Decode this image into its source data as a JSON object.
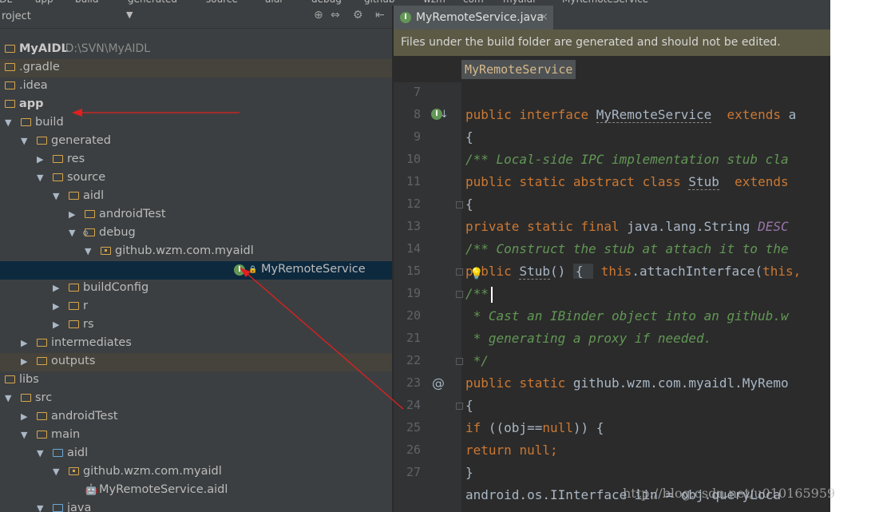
{
  "breadcrumbs": [
    "MyAIDL",
    "app",
    "build",
    "generated",
    "source",
    "aidl",
    "debug",
    "github",
    "wzm",
    "com",
    "myaidl",
    "MyRemoteService"
  ],
  "project_panel": {
    "label": "roject",
    "toolbar_icons": [
      "target-icon",
      "collapse-icon",
      "gear-icon",
      "hide-panel-icon"
    ]
  },
  "tree": [
    {
      "label": "MyAIDL",
      "suffix": "D:\\SVN\\MyAIDL",
      "depth": 0,
      "chevron": "",
      "icon": "module",
      "bold": true
    },
    {
      "label": ".gradle",
      "depth": 0,
      "chevron": "",
      "icon": "folder",
      "highlight": true
    },
    {
      "label": ".idea",
      "depth": 0,
      "chevron": "",
      "icon": "folder"
    },
    {
      "label": "app",
      "depth": 0,
      "chevron": "",
      "icon": "module",
      "bold": true
    },
    {
      "label": "build",
      "depth": 0,
      "chevron": "down",
      "icon": "folder"
    },
    {
      "label": "generated",
      "depth": 1,
      "chevron": "down",
      "icon": "folder"
    },
    {
      "label": "res",
      "depth": 2,
      "chevron": "right",
      "icon": "folder"
    },
    {
      "label": "source",
      "depth": 2,
      "chevron": "down",
      "icon": "folder"
    },
    {
      "label": "aidl",
      "depth": 3,
      "chevron": "down",
      "icon": "folder"
    },
    {
      "label": "androidTest",
      "depth": 4,
      "chevron": "right",
      "icon": "folder"
    },
    {
      "label": "debug",
      "depth": 4,
      "chevron": "down",
      "icon": "folder-gear"
    },
    {
      "label": "github.wzm.com.myaidl",
      "depth": 5,
      "chevron": "down",
      "icon": "package"
    },
    {
      "label": "MyRemoteService",
      "depth": 7,
      "chevron": "",
      "icon": "interface",
      "selected": true
    },
    {
      "label": "buildConfig",
      "depth": 3,
      "chevron": "right",
      "icon": "folder"
    },
    {
      "label": "r",
      "depth": 3,
      "chevron": "right",
      "icon": "folder"
    },
    {
      "label": "rs",
      "depth": 3,
      "chevron": "right",
      "icon": "folder"
    },
    {
      "label": "intermediates",
      "depth": 1,
      "chevron": "right",
      "icon": "folder"
    },
    {
      "label": "outputs",
      "depth": 1,
      "chevron": "right",
      "icon": "folder",
      "highlight": true
    },
    {
      "label": "libs",
      "depth": 0,
      "chevron": "",
      "icon": "folder"
    },
    {
      "label": "src",
      "depth": 0,
      "chevron": "down",
      "icon": "folder"
    },
    {
      "label": "androidTest",
      "depth": 1,
      "chevron": "right",
      "icon": "folder"
    },
    {
      "label": "main",
      "depth": 1,
      "chevron": "down",
      "icon": "folder"
    },
    {
      "label": "aidl",
      "depth": 2,
      "chevron": "down",
      "icon": "folder-blue"
    },
    {
      "label": "github.wzm.com.myaidl",
      "depth": 3,
      "chevron": "down",
      "icon": "package"
    },
    {
      "label": "MyRemoteService.aidl",
      "depth": 4,
      "chevron": "",
      "icon": "android"
    },
    {
      "label": "java",
      "depth": 2,
      "chevron": "down",
      "icon": "folder-blue"
    }
  ],
  "editor": {
    "tab_label": "MyRemoteService.java",
    "tab_badge": "I",
    "banner": "Files under the build folder are generated and should not be edited.",
    "breadcrumb_chip": "MyRemoteService",
    "lines": [
      {
        "n": "7",
        "parts": []
      },
      {
        "n": "8",
        "marker": "implements-icon",
        "parts": [
          [
            "kw",
            "public "
          ],
          [
            "kw",
            "interface "
          ],
          [
            "ul",
            "MyRemoteService"
          ],
          [
            "",
            "  "
          ],
          [
            "kw",
            "extends "
          ],
          [
            "",
            "a"
          ]
        ]
      },
      {
        "n": "9",
        "parts": [
          [
            "",
            "{"
          ]
        ]
      },
      {
        "n": "10",
        "parts": [
          [
            "cm",
            "/** Local-side IPC implementation stub cla"
          ]
        ]
      },
      {
        "n": "11",
        "parts": [
          [
            "kw",
            "public "
          ],
          [
            "kw",
            "static "
          ],
          [
            "kw",
            "abstract "
          ],
          [
            "kw",
            "class "
          ],
          [
            "ul",
            "Stub"
          ],
          [
            "",
            "  "
          ],
          [
            "kw",
            "extends "
          ]
        ]
      },
      {
        "n": "12",
        "fold": true,
        "parts": [
          [
            "",
            "{"
          ]
        ]
      },
      {
        "n": "13",
        "parts": [
          [
            "kw",
            "private "
          ],
          [
            "kw",
            "static "
          ],
          [
            "kw",
            "final "
          ],
          [
            "",
            "java.lang.String "
          ],
          [
            "ital",
            "DESC"
          ]
        ]
      },
      {
        "n": "14",
        "parts": [
          [
            "cm",
            "/** Construct the stub at attach it to the"
          ]
        ]
      },
      {
        "n": "15",
        "fold": true,
        "bulb": true,
        "parts": [
          [
            "kw",
            "public "
          ],
          [
            "ul",
            "Stub"
          ],
          [
            "",
            "() "
          ],
          [
            "foldchip",
            "{ "
          ],
          [
            "",
            " "
          ],
          [
            "kw",
            "this"
          ],
          [
            "",
            ".attachInterface("
          ],
          [
            "kw",
            "this"
          ],
          [
            "kw",
            ","
          ]
        ]
      },
      {
        "n": "19",
        "fold": true,
        "caret": true,
        "parts": [
          [
            "cm",
            "/**"
          ]
        ]
      },
      {
        "n": "20",
        "parts": [
          [
            "cm",
            " * Cast an IBinder object into an github.w"
          ]
        ]
      },
      {
        "n": "21",
        "parts": [
          [
            "cm",
            " * generating a proxy if needed."
          ]
        ]
      },
      {
        "n": "22",
        "fold": true,
        "parts": [
          [
            "cm",
            " */"
          ]
        ]
      },
      {
        "n": "23",
        "marker": "override-icon",
        "parts": [
          [
            "kw",
            "public "
          ],
          [
            "kw",
            "static "
          ],
          [
            "",
            "github.wzm.com.myaidl.MyRemo"
          ]
        ]
      },
      {
        "n": "24",
        "fold": true,
        "parts": [
          [
            "",
            "{"
          ]
        ]
      },
      {
        "n": "25",
        "parts": [
          [
            "kw",
            "if "
          ],
          [
            "",
            "((obj=="
          ],
          [
            "kw",
            "null"
          ],
          [
            "",
            ")) {"
          ]
        ]
      },
      {
        "n": "26",
        "parts": [
          [
            "kw",
            "return "
          ],
          [
            "kw",
            "null"
          ],
          [
            "kw",
            ";"
          ]
        ]
      },
      {
        "n": "27",
        "parts": [
          [
            "",
            "}"
          ]
        ]
      },
      {
        "n": "",
        "parts": [
          [
            "",
            "android.os.IInterface iin = obj.queryLoca"
          ]
        ]
      }
    ]
  },
  "watermark": "http://blog.csdn.net/u010165959",
  "colors": {
    "accent_arrow": "#e02020",
    "selection": "#0d293e",
    "banner": "#5c5a44"
  }
}
